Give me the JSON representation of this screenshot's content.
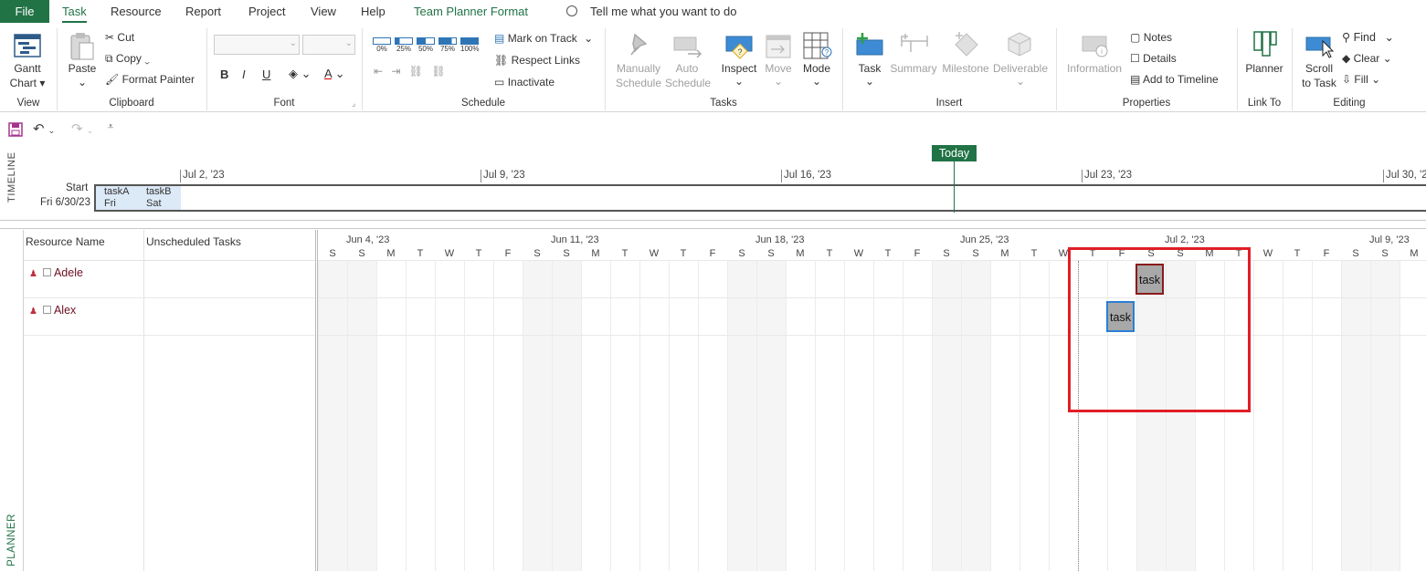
{
  "ribbon_tabs": {
    "file": "File",
    "tabs": [
      "Task",
      "Resource",
      "Report",
      "Project",
      "View",
      "Help",
      "Team Planner Format"
    ],
    "active": "Task",
    "tell_me": "Tell me what you want to do"
  },
  "ribbon": {
    "view": {
      "gantt_line1": "Gantt",
      "gantt_line2": "Chart",
      "label": "View"
    },
    "clipboard": {
      "paste": "Paste",
      "cut": "Cut",
      "copy": "Copy",
      "format_painter": "Format Painter",
      "label": "Clipboard"
    },
    "font": {
      "bold": "B",
      "italic": "I",
      "underline": "U",
      "font_color": "A",
      "label": "Font"
    },
    "schedule": {
      "percents": [
        "0%",
        "25%",
        "50%",
        "75%",
        "100%"
      ],
      "mark_on_track": "Mark on Track",
      "respect_links": "Respect Links",
      "inactivate": "Inactivate",
      "label": "Schedule"
    },
    "tasks": {
      "manually_1": "Manually",
      "manually_2": "Schedule",
      "auto_1": "Auto",
      "auto_2": "Schedule",
      "inspect": "Inspect",
      "move": "Move",
      "mode": "Mode",
      "label": "Tasks"
    },
    "insert": {
      "task": "Task",
      "summary": "Summary",
      "milestone": "Milestone",
      "deliverable": "Deliverable",
      "label": "Insert"
    },
    "properties": {
      "information": "Information",
      "notes": "Notes",
      "details": "Details",
      "add_to_timeline": "Add to Timeline",
      "label": "Properties"
    },
    "link_to": {
      "planner": "Planner",
      "label": "Link To"
    },
    "editing": {
      "scroll_1": "Scroll",
      "scroll_2": "to Task",
      "find": "Find",
      "clear": "Clear",
      "fill": "Fill",
      "label": "Editing"
    }
  },
  "timeline": {
    "vertical_label": "TIMELINE",
    "start_label": "Start",
    "start_date": "Fri 6/30/23",
    "dates": [
      "Jul 2, '23",
      "Jul 9, '23",
      "Jul 16, '23",
      "Jul 23, '23",
      "Jul 30, '2"
    ],
    "today": "Today",
    "tasks": [
      {
        "name": "taskA",
        "day": "Fri"
      },
      {
        "name": "taskB",
        "day": "Sat"
      }
    ]
  },
  "planner": {
    "vertical_label": "PLANNER",
    "col_resource": "Resource Name",
    "col_unscheduled": "Unscheduled Tasks",
    "resources": [
      "Adele",
      "Alex"
    ],
    "weeks": [
      "Jun 4, '23",
      "Jun 11, '23",
      "Jun 18, '23",
      "Jun 25, '23",
      "Jul 2, '23",
      "Jul 9, '23"
    ],
    "days": [
      "S",
      "S",
      "M",
      "T",
      "W",
      "T",
      "F",
      "S",
      "S",
      "M",
      "T",
      "W",
      "T",
      "F",
      "S",
      "S",
      "M",
      "T",
      "W",
      "T",
      "F",
      "S",
      "S",
      "M",
      "T",
      "W",
      "T",
      "F",
      "S",
      "S",
      "M",
      "T",
      "W",
      "T",
      "F",
      "S",
      "S",
      "M"
    ],
    "tasks": [
      {
        "resource": "Adele",
        "label": "task",
        "day_index": 28,
        "border": "#8b1a1a"
      },
      {
        "resource": "Alex",
        "label": "task",
        "day_index": 27,
        "border": "#2a7fd4"
      }
    ]
  },
  "colors": {
    "accent": "#217346",
    "highlight": "#e01e26",
    "task_fill": "#a8a8a8"
  }
}
